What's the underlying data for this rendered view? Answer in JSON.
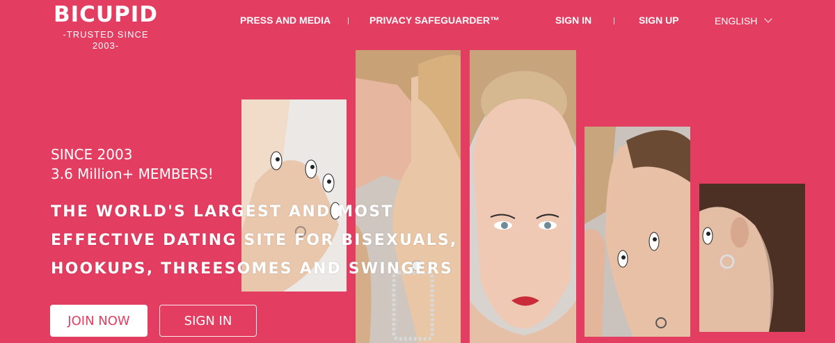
{
  "logo": {
    "title": "BICUPID",
    "subtitle": "-TRUSTED SINCE 2003-"
  },
  "nav": {
    "press": "PRESS AND MEDIA",
    "privacy": "PRIVACY SAFEGUARDER™",
    "sign_in": "SIGN IN",
    "sign_up": "SIGN UP",
    "language": "ENGLISH"
  },
  "hero": {
    "since": "SINCE 2003",
    "members": "3.6 Million+ MEMBERS!",
    "tagline": [
      "THE WORLD'S LARGEST AND MOST",
      "EFFECTIVE DATING SITE FOR BISEXUALS,",
      "HOOKUPS, THREESOMES AND SWINGERS"
    ],
    "join_button": "JOIN NOW",
    "signin_button": "SIGN IN"
  },
  "colors": {
    "brand": "#e33d61",
    "button_bg": "#ffffff"
  }
}
